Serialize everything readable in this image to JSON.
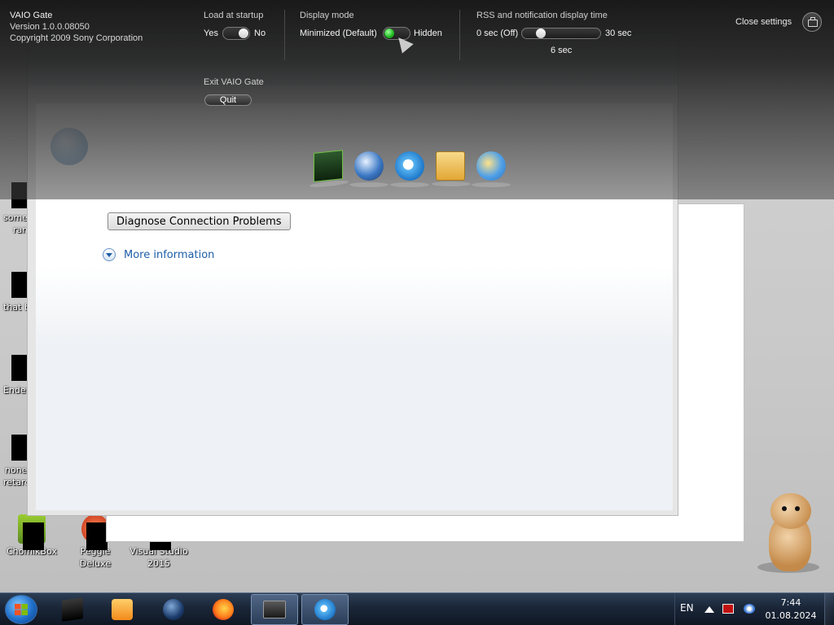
{
  "desktop": {
    "left_fragments": [
      "some",
      "ran",
      "that b",
      "Ender",
      "none",
      "retard"
    ],
    "icons": [
      {
        "label": "ChomikBox"
      },
      {
        "label": "Peggle Deluxe"
      },
      {
        "label": "Visual Studio 2015"
      }
    ]
  },
  "browser": {
    "page": {
      "diagnose_button": "Diagnose Connection Problems",
      "more_info_link": "More information"
    }
  },
  "vaio": {
    "app_name": "VAIO Gate",
    "version": "Version 1.0.0.08050",
    "copyright": "Copyright 2009 Sony Corporation",
    "load_at_startup": {
      "label": "Load at startup",
      "yes": "Yes",
      "no": "No",
      "value": "Yes"
    },
    "exit": {
      "label": "Exit VAIO Gate",
      "button": "Quit"
    },
    "display_mode": {
      "label": "Display mode",
      "minimized": "Minimized (Default)",
      "hidden": "Hidden",
      "value": "Minimized (Default)"
    },
    "rss_time": {
      "label": "RSS and notification display time",
      "min": "0 sec (Off)",
      "max": "30 sec",
      "value_label": "6 sec",
      "value": 6,
      "range": [
        0,
        30
      ]
    },
    "close_settings": "Close settings",
    "dock_icons": [
      "vaio-media-icon",
      "globe-download-icon",
      "internet-explorer-icon",
      "mail-icon",
      "messenger-icon"
    ]
  },
  "taskbar": {
    "items": [
      "start-button",
      "app-box-icon",
      "media-player-icon",
      "orb-app-icon",
      "firefox-icon",
      "screen-app-icon",
      "internet-explorer-icon"
    ],
    "language": "EN",
    "time": "7:44",
    "date": "01.08.2024"
  }
}
